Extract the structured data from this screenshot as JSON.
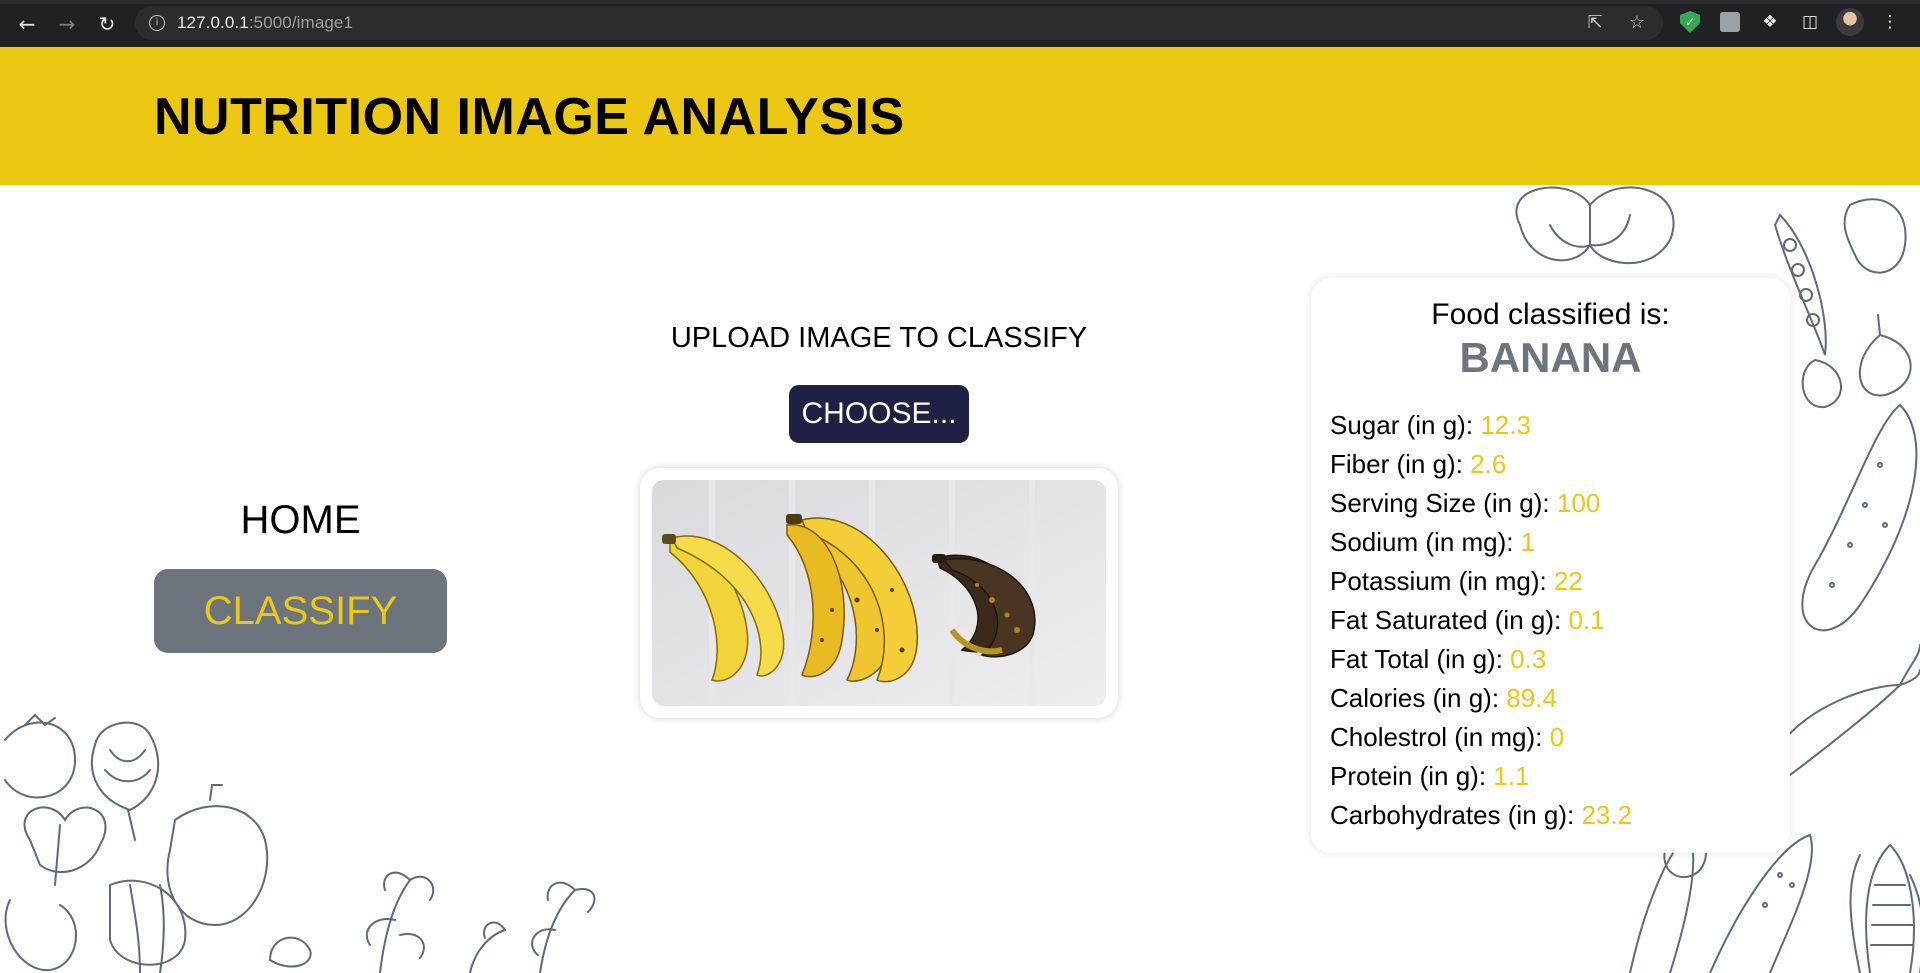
{
  "browser": {
    "url_host": "127.0.0.1",
    "url_path": ":5000/image1"
  },
  "header": {
    "title": "NUTRITION IMAGE ANALYSIS"
  },
  "nav": {
    "home_label": "HOME",
    "classify_label": "CLASSIFY"
  },
  "upload": {
    "title": "UPLOAD IMAGE TO CLASSIFY",
    "choose_label": "CHOOSE..."
  },
  "result": {
    "label": "Food classified is:",
    "food": "BANANA",
    "nutrients": [
      {
        "name": "Sugar (in g):",
        "value": "12.3"
      },
      {
        "name": "Fiber (in g):",
        "value": "2.6"
      },
      {
        "name": "Serving Size (in g):",
        "value": "100"
      },
      {
        "name": "Sodium (in mg):",
        "value": "1"
      },
      {
        "name": "Potassium (in mg):",
        "value": "22"
      },
      {
        "name": "Fat Saturated (in g):",
        "value": "0.1"
      },
      {
        "name": "Fat Total (in g):",
        "value": "0.3"
      },
      {
        "name": "Calories (in g):",
        "value": "89.4"
      },
      {
        "name": "Cholestrol (in mg):",
        "value": "0"
      },
      {
        "name": "Protein (in g):",
        "value": "1.1"
      },
      {
        "name": "Carbohydrates (in g):",
        "value": "23.2"
      }
    ]
  },
  "colors": {
    "header_bg": "#ecc813",
    "accent_yellow": "#ecc813",
    "classify_bg": "#6c757d",
    "choose_bg": "#1e2143",
    "food_name": "#6c757d"
  },
  "icons": [
    "back-arrow-icon",
    "forward-arrow-icon",
    "reload-icon",
    "info-icon",
    "share-icon",
    "star-icon",
    "shield-extension-icon",
    "extension-square-icon",
    "puzzle-icon",
    "side-panel-icon",
    "profile-avatar",
    "kebab-menu-icon"
  ]
}
